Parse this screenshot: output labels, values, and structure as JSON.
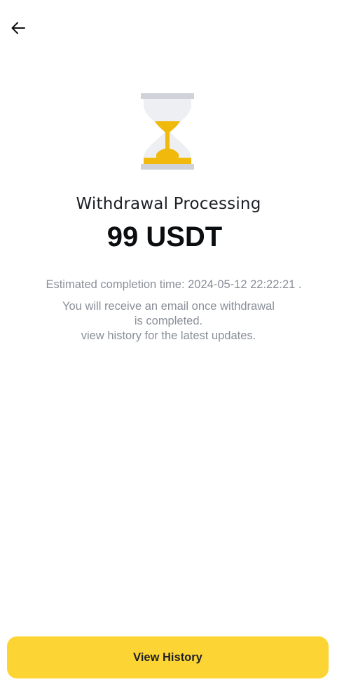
{
  "header": {
    "back_icon": "arrow-left-icon"
  },
  "status": {
    "icon": "hourglass-icon",
    "title": "Withdrawal Processing",
    "amount": "99 USDT",
    "estimated_completion": "Estimated completion time: 2024-05-12 22:22:21 .",
    "note_lines": [
      "You will receive an email once withdrawal",
      "is completed.",
      "view history for the latest updates."
    ]
  },
  "footer": {
    "view_history_label": "View History"
  },
  "colors": {
    "accent": "#fcd535",
    "hourglass_sand": "#f0b90b",
    "hourglass_frame": "#cfd2d8",
    "secondary_text": "#8a8f98"
  }
}
